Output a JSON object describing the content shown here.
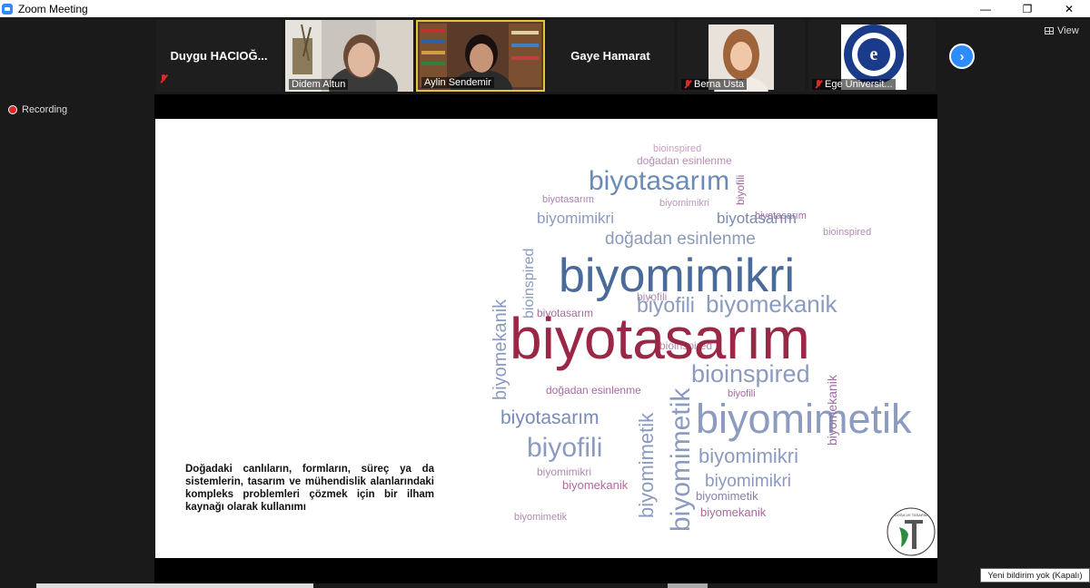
{
  "window": {
    "title": "Zoom Meeting",
    "controls": [
      "—",
      "❐",
      "✕"
    ]
  },
  "participants": [
    {
      "name": "Duygu  HACIOĞ...",
      "muted": true,
      "has_video": false
    },
    {
      "name": "Didem Altun",
      "muted": false,
      "has_video": true
    },
    {
      "name": "Aylin Sendemir",
      "muted": true,
      "has_video": true
    },
    {
      "name": "Gaye Hamarat",
      "muted": false,
      "has_video": false
    },
    {
      "name": "Berna Usta",
      "muted": true,
      "has_video": true
    },
    {
      "name": "Ege Üniversit...",
      "muted": true,
      "has_video": true
    }
  ],
  "view_button": "View",
  "recording_label": "Recording",
  "slide": {
    "description": "Doğadaki canlıların, formların, süreç ya da sistemlerin, tasarım ve mühendislik alanlarındaki kompleks problemleri çözmek için  bir ilham kaynağı olarak kullanımı",
    "word_cloud": [
      "biyotasarım",
      "biyomimikri",
      "biyofili",
      "biyomekanik",
      "biyomimetik",
      "bioinspired",
      "doğadan esinlenme",
      "biyotasarım",
      "biyomimikri",
      "biyofili",
      "bioinspired",
      "biyomimikri",
      "biyotasarım",
      "biyofili",
      "biyomimetik",
      "biyotasarım",
      "biyomimikri",
      "doğadan esinlenme",
      "bioinspired",
      "biyomekanik",
      "biyomimetik",
      "biyotasarım",
      "biyofili",
      "biyomekanik",
      "bioinspired",
      "biyomimetik"
    ],
    "logo_text": "DOĞA VE TASARIM"
  },
  "colors": {
    "accent_blue": "#2d8cff",
    "cloud_blue": "#5a7ba6",
    "cloud_red": "#9b2747",
    "cloud_purple": "#a06aa0",
    "muted_red": "#e02828"
  },
  "notification_tooltip": "Yeni bildirim yok (Kapalı)"
}
